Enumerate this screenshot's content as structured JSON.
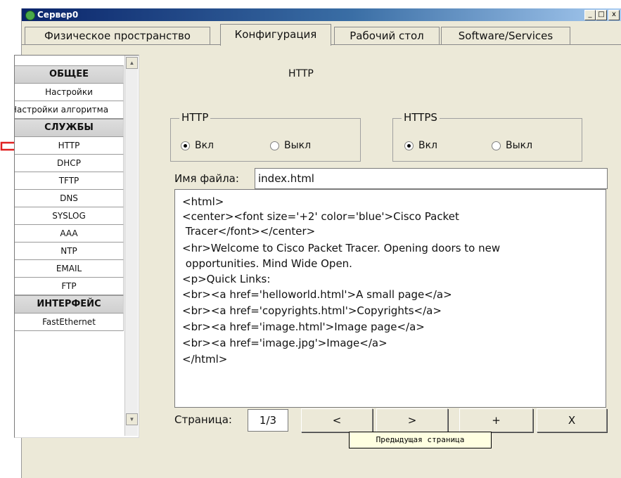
{
  "window": {
    "title": "Сервер0",
    "controls": [
      "_",
      "□",
      "x"
    ]
  },
  "tabs": [
    {
      "label": "Физическое пространство",
      "active": false
    },
    {
      "label": "Конфигурация",
      "active": true
    },
    {
      "label": "Рабочий стол",
      "active": false
    },
    {
      "label": "Software/Services",
      "active": false
    }
  ],
  "sidebar": {
    "items": [
      {
        "label": "ОБЩЕЕ",
        "type": "header"
      },
      {
        "label": "Настройки",
        "type": "item"
      },
      {
        "label": "Настройки алгоритма",
        "type": "item"
      },
      {
        "label": "СЛУЖБЫ",
        "type": "header"
      },
      {
        "label": "HTTP",
        "type": "item",
        "selected": true
      },
      {
        "label": "DHCP",
        "type": "item"
      },
      {
        "label": "TFTP",
        "type": "item"
      },
      {
        "label": "DNS",
        "type": "item"
      },
      {
        "label": "SYSLOG",
        "type": "item"
      },
      {
        "label": "AAA",
        "type": "item"
      },
      {
        "label": "NTP",
        "type": "item"
      },
      {
        "label": "EMAIL",
        "type": "item"
      },
      {
        "label": "FTP",
        "type": "item"
      },
      {
        "label": "ИНТЕРФЕЙС",
        "type": "header"
      },
      {
        "label": "FastEthernet",
        "type": "item"
      }
    ]
  },
  "main": {
    "heading": "HTTP",
    "http_group": {
      "title": "HTTP",
      "on_label": "Вкл",
      "off_label": "Выкл",
      "selected": "on"
    },
    "https_group": {
      "title": "HTTPS",
      "on_label": "Вкл",
      "off_label": "Выкл",
      "selected": "on"
    },
    "filename_label": "Имя файла:",
    "filename_value": "index.html",
    "editor_lines": [
      "<html>",
      "<center><font size='+2' color='blue'>Cisco Packet",
      " Tracer</font></center>",
      "<hr>Welcome to Cisco Packet Tracer. Opening doors to new",
      " opportunities. Mind Wide Open.",
      "<p>Quick Links:",
      "<br><a href='helloworld.html'>A small page</a>",
      "<br><a href='copyrights.html'>Copyrights</a>",
      "<br><a href='image.html'>Image page</a>",
      "<br><a href='image.jpg'>Image</a>",
      "</html>"
    ],
    "page_label": "Страница:",
    "page_value": "1/3",
    "buttons": {
      "prev": "<",
      "next": ">",
      "add": "+",
      "delete": "X"
    },
    "tooltip": "Предыдущая страница"
  },
  "colors": {
    "annotation_arrow": "#e02020",
    "titlebar_start": "#0a246a",
    "titlebar_end": "#a6caf0"
  }
}
